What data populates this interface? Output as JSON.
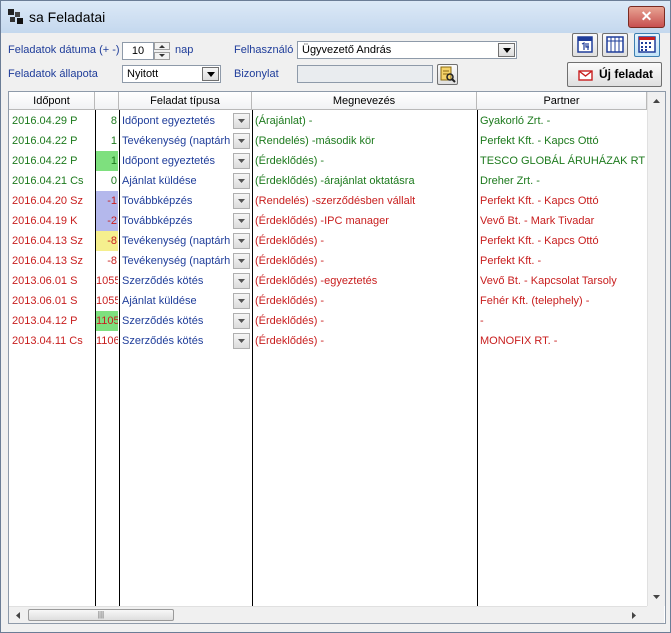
{
  "window": {
    "title": "sa Feladatai",
    "close_symbol": "✕"
  },
  "filters": {
    "date_label": "Feladatok dátuma (+ -)",
    "date_value": "10",
    "date_unit": "nap",
    "status_label": "Feladatok állapota",
    "status_value": "Nyitott",
    "user_label": "Felhasználó",
    "user_value": "Ügyvezető András",
    "doc_label": "Bizonylat",
    "doc_value": ""
  },
  "toolbar": {
    "new_task_label": "Új feladat"
  },
  "table": {
    "headers": {
      "time": "Időpont",
      "type": "Feladat típusa",
      "name": "Megnevezés",
      "partner": "Partner"
    },
    "rows": [
      {
        "time": "2016.04.29 P",
        "num": "8",
        "type": "Időpont egyeztetés",
        "name": "(Árajánlat) -",
        "partner": "Gyakorló Zrt. -",
        "time_color": "#1d7a1d",
        "num_bg": "",
        "text_color": "#1d7a1d",
        "type_color": "#1f3d9a"
      },
      {
        "time": "2016.04.22 P",
        "num": "1",
        "type": "Tevékenység (naptárh",
        "name": "(Rendelés) -második kör",
        "partner": "Perfekt Kft. - Kapcs Ottó",
        "time_color": "#1d7a1d",
        "num_bg": "",
        "text_color": "#1d7a1d",
        "type_color": "#1f3d9a"
      },
      {
        "time": "2016.04.22 P",
        "num": "1",
        "type": "Időpont egyeztetés",
        "name": "(Érdeklődés) -",
        "partner": "TESCO GLOBÁL ÁRUHÁZAK RT",
        "time_color": "#1d7a1d",
        "num_bg": "#7ee07e",
        "text_color": "#1d7a1d",
        "type_color": "#1f3d9a"
      },
      {
        "time": "2016.04.21 Cs",
        "num": "0",
        "type": "Ajánlat küldése",
        "name": "(Érdeklődés) -árajánlat oktatásra",
        "partner": "Dreher Zrt. -",
        "time_color": "#1d7a1d",
        "num_bg": "",
        "text_color": "#1d7a1d",
        "type_color": "#1f3d9a"
      },
      {
        "time": "2016.04.20 Sz",
        "num": "-1",
        "type": "Továbbképzés",
        "name": "(Rendelés) -szerződésben vállalt",
        "partner": "Perfekt Kft. - Kapcs Ottó",
        "time_color": "#c81e1e",
        "num_bg": "#b4b8ec",
        "text_color": "#c81e1e",
        "type_color": "#1f3d9a"
      },
      {
        "time": "2016.04.19 K",
        "num": "-2",
        "type": "Továbbképzés",
        "name": "(Érdeklődés) -IPC manager",
        "partner": "Vevő Bt. - Mark Tivadar",
        "time_color": "#c81e1e",
        "num_bg": "#b4b8ec",
        "text_color": "#c81e1e",
        "type_color": "#1f3d9a"
      },
      {
        "time": "2016.04.13 Sz",
        "num": "-8",
        "type": "Tevékenység (naptárh",
        "name": "(Érdeklődés) -",
        "partner": "Perfekt Kft. - Kapcs Ottó",
        "time_color": "#c81e1e",
        "num_bg": "#f5ef8e",
        "text_color": "#c81e1e",
        "type_color": "#1f3d9a"
      },
      {
        "time": "2016.04.13 Sz",
        "num": "-8",
        "type": "Tevékenység (naptárh",
        "name": "(Érdeklődés) -",
        "partner": "Perfekt Kft. -",
        "time_color": "#c81e1e",
        "num_bg": "",
        "text_color": "#c81e1e",
        "type_color": "#1f3d9a"
      },
      {
        "time": "2013.06.01 S",
        "num": "1055",
        "type": "Szerződés kötés",
        "name": "(Érdeklődés) -egyeztetés",
        "partner": "Vevő Bt. - Kapcsolat Tarsoly",
        "time_color": "#c81e1e",
        "num_bg": "",
        "text_color": "#c81e1e",
        "type_color": "#1f3d9a"
      },
      {
        "time": "2013.06.01 S",
        "num": "1055",
        "type": "Ajánlat küldése",
        "name": "(Érdeklődés) -",
        "partner": "Fehér Kft. (telephely) -",
        "time_color": "#c81e1e",
        "num_bg": "",
        "text_color": "#c81e1e",
        "type_color": "#1f3d9a"
      },
      {
        "time": "2013.04.12 P",
        "num": "1105",
        "type": "Szerződés kötés",
        "name": "(Érdeklődés) -",
        "partner": " -",
        "time_color": "#c81e1e",
        "num_bg": "#7ee07e",
        "text_color": "#c81e1e",
        "type_color": "#1f3d9a"
      },
      {
        "time": "2013.04.11 Cs",
        "num": "1106",
        "type": "Szerződés kötés",
        "name": "(Érdeklődés) -",
        "partner": "MONOFIX RT. -",
        "time_color": "#c81e1e",
        "num_bg": "",
        "text_color": "#c81e1e",
        "type_color": "#1f3d9a"
      }
    ]
  },
  "icons": [
    "app-icon",
    "close-icon",
    "spinner-up-icon",
    "spinner-down-icon",
    "dropdown-arrow-icon",
    "document-search-icon",
    "calendar-14-icon",
    "calendar-week-icon",
    "calendar-month-icon",
    "envelope-icon"
  ]
}
